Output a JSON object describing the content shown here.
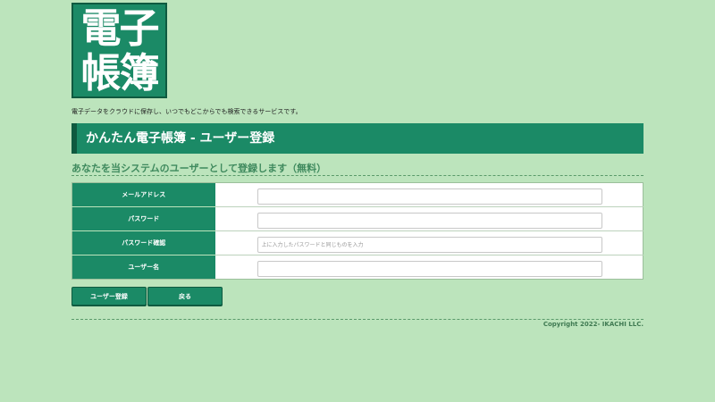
{
  "logo": {
    "line1": "電子",
    "line2": "帳簿"
  },
  "tagline": "電子データをクラウドに保存し、いつでもどこからでも検索できるサービスです。",
  "header": {
    "title": "かんたん電子帳簿 - ユーザー登録"
  },
  "subtitle": "あなたを当システムのユーザーとして登録します（無料）",
  "form": {
    "fields": [
      {
        "label": "メールアドレス",
        "value": "",
        "placeholder": ""
      },
      {
        "label": "パスワード",
        "value": "",
        "placeholder": ""
      },
      {
        "label": "パスワード確認",
        "value": "",
        "placeholder": "上に入力したパスワードと同じものを入力"
      },
      {
        "label": "ユーザー名",
        "value": "",
        "placeholder": ""
      }
    ]
  },
  "buttons": {
    "register": "ユーザー登録",
    "back": "戻る"
  },
  "footer": {
    "copyright": "Copyright 2022- IKACHI LLC."
  },
  "colors": {
    "background": "#bce4bc",
    "accent": "#1b8a66",
    "accent_dark": "#0f5a40"
  }
}
